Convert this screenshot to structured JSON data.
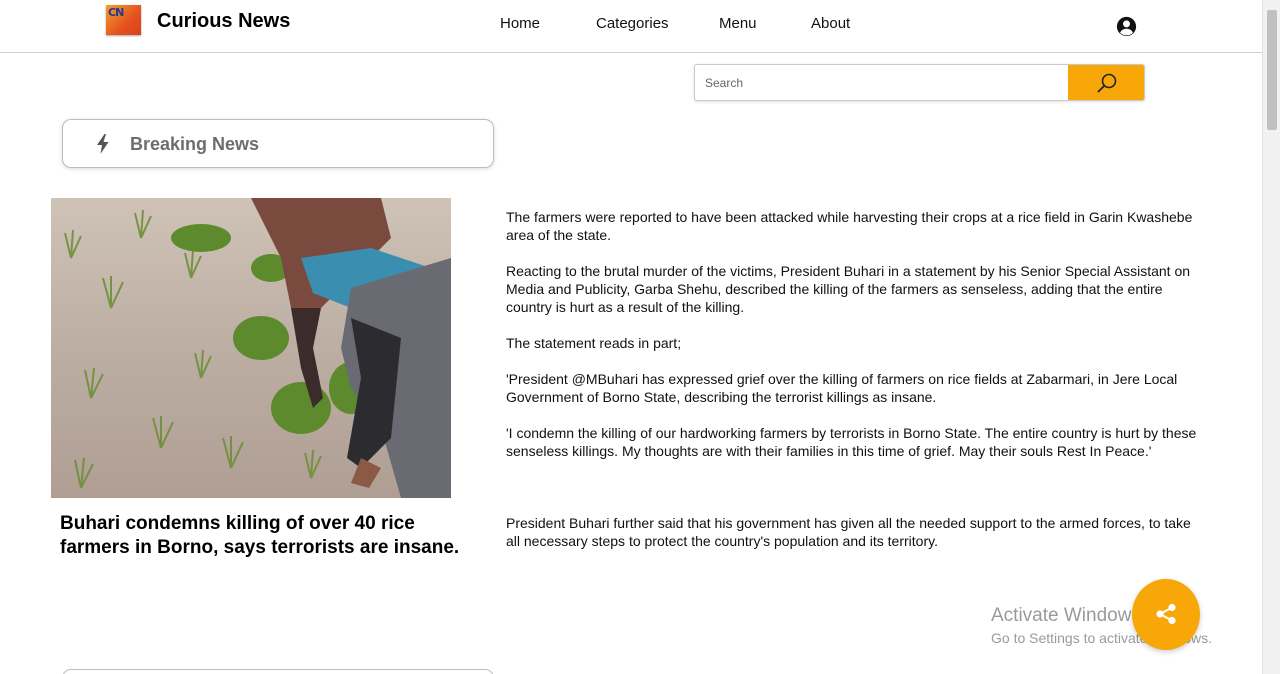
{
  "navbar": {
    "logo_text": "CN",
    "brand": "Curious News",
    "links": [
      "Home",
      "Categories",
      "Menu",
      "About"
    ],
    "user_icon": "account-circle-icon"
  },
  "search": {
    "placeholder": "Search",
    "button_icon": "magnifier-icon",
    "accent_color": "#f7a707"
  },
  "breaking": {
    "icon": "bolt-icon",
    "label": "Breaking News"
  },
  "article": {
    "image_alt": "Farmers harvesting rice seedlings in a flooded field",
    "headline": "Buhari condemns killing of over 40 rice farmers in Borno, says terrorists are insane.",
    "paragraphs": [
      "The farmers were reported to have been attacked while harvesting their crops at a rice field in Garin Kwashebe area of the state.",
      "Reacting to the brutal murder of the victims, President Buhari in a statement by his Senior Special Assistant on Media and Publicity, Garba Shehu, described the killing of the farmers as senseless, adding that the entire country is hurt as a result of the killing.",
      "The statement reads in part;",
      "'President @MBuhari has expressed grief over the killing of farmers on rice fields at Zabarmari, in Jere Local Government of Borno State, describing the terrorist killings as insane.",
      "'I condemn the killing of our hardworking farmers by terrorists in Borno State. The entire country is hurt by these senseless killings. My thoughts are with their families in this time of grief. May their souls Rest In Peace.'"
    ],
    "final_paragraph": "President Buhari further said that his government has given all the needed support to the armed forces, to take all necessary steps to protect the country's population and its territory."
  },
  "share": {
    "icon": "share-icon",
    "color": "#f7a707"
  },
  "watermark": {
    "title": "Activate Windows",
    "subtitle": "Go to Settings to activate Windows."
  }
}
